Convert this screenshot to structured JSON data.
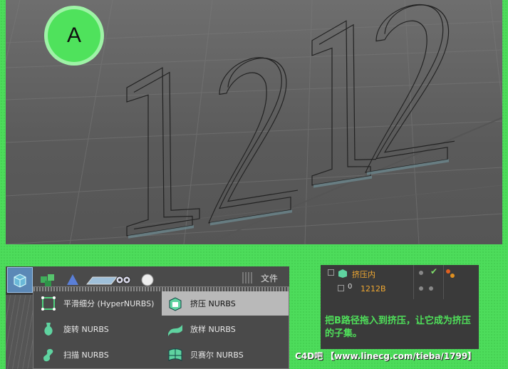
{
  "badge": {
    "letter": "A"
  },
  "viewport": {
    "text_3d": "1212"
  },
  "toolbar": {
    "file_label": "文件"
  },
  "menu": {
    "items": [
      {
        "label": "平滑细分 (HyperNURBS)",
        "icon": "hypernurbs-icon",
        "selected": false
      },
      {
        "label": "挤压 NURBS",
        "icon": "extrude-nurbs-icon",
        "selected": true
      },
      {
        "label": "旋转 NURBS",
        "icon": "lathe-nurbs-icon",
        "selected": false
      },
      {
        "label": "放样 NURBS",
        "icon": "loft-nurbs-icon",
        "selected": false
      },
      {
        "label": "扫描 NURBS",
        "icon": "sweep-nurbs-icon",
        "selected": false
      },
      {
        "label": "贝赛尔 NURBS",
        "icon": "bezier-nurbs-icon",
        "selected": false
      }
    ]
  },
  "object_manager": {
    "row1_label": "挤压内",
    "row2_label": "1212B",
    "row2_prefix": "0"
  },
  "note": "把B路径拖入到挤压，让它成为挤压的子集。",
  "watermark": "C4D吧 【www.linecg.com/tieba/1799】",
  "colors": {
    "accent_green": "#4ddc5b",
    "label_orange": "#f0a832",
    "selected_blue": "#5b88b6"
  }
}
